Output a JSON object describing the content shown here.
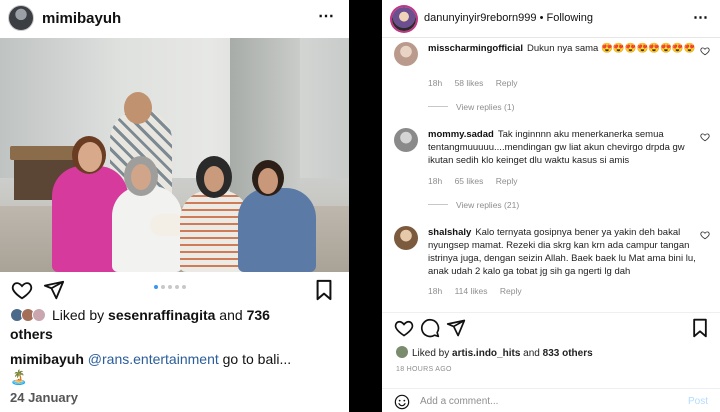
{
  "left_post": {
    "username": "mimibayuh",
    "more_icon": "⋯",
    "carousel": {
      "count": 5,
      "active_index": 0
    },
    "likes": {
      "prefix": "Liked by ",
      "user": "sesenraffinagita",
      "middle": " and ",
      "count": "736",
      "suffix": "others"
    },
    "caption": {
      "username": "mimibayuh",
      "mention": "@rans.entertainment",
      "text": "go to bali...",
      "emoji": "🏝️"
    },
    "date": "24 January"
  },
  "right_post": {
    "username": "danunyinyir9reborn999",
    "separator": "•",
    "following": "Following",
    "more_icon": "⋯",
    "comments": [
      {
        "username": "misscharmingofficial",
        "text": "Dukun nya sama 😍😍😍😍😍😍😍😍",
        "time": "18h",
        "likes": "58 likes",
        "reply": "Reply",
        "view_replies": "View replies (1)"
      },
      {
        "username": "mommy.sadad",
        "text": "Tak inginnnn aku menerkanerka semua tentangmuuuuu....mendingan gw liat akun chevirgo drpda gw ikutan sedih klo keinget dlu waktu kasus si amis",
        "time": "18h",
        "likes": "65 likes",
        "reply": "Reply",
        "view_replies": "View replies (21)"
      },
      {
        "username": "shalshaly",
        "text": "Kalo ternyata gosipnya bener ya yakin deh bakal nyungsep mamat. Rezeki dia skrg kan krn ada campur tangan istrinya juga, dengan seizin Allah. Baek baek lu Mat ama bini lu, anak udah 2 kalo ga tobat jg sih ga ngerti lg dah",
        "time": "18h",
        "likes": "114 likes",
        "reply": "Reply"
      }
    ],
    "likes": {
      "prefix": "Liked by ",
      "user": "artis.indo_hits",
      "middle": " and ",
      "count": "833 others"
    },
    "time_ago": "18 HOURS AGO",
    "add_comment_placeholder": "Add a comment...",
    "post_label": "Post"
  },
  "colors": {
    "link_blue": "#2a5d9a",
    "carousel_active": "#3897f0",
    "post_disabled": "#b3dbff",
    "meta_gray": "#8e8e8e"
  }
}
